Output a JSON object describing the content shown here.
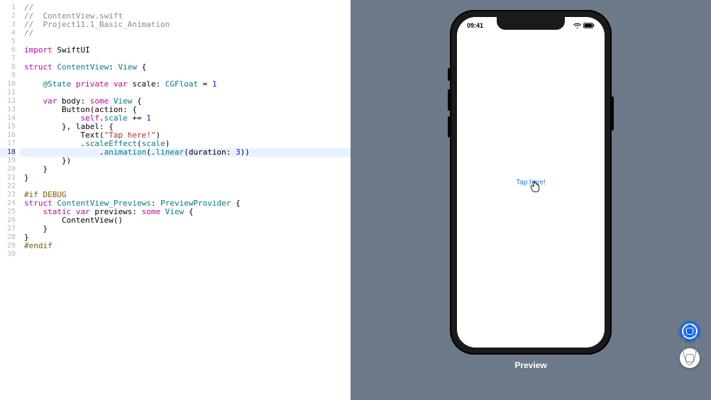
{
  "editor": {
    "highlighted_line": 18,
    "lines": [
      {
        "n": 1,
        "tokens": [
          {
            "t": "//",
            "c": "tok-comment"
          }
        ]
      },
      {
        "n": 2,
        "tokens": [
          {
            "t": "//  ContentView.swift",
            "c": "tok-comment"
          }
        ]
      },
      {
        "n": 3,
        "tokens": [
          {
            "t": "//  Project11.1_Basic_Animation",
            "c": "tok-comment"
          }
        ]
      },
      {
        "n": 4,
        "tokens": [
          {
            "t": "//",
            "c": "tok-comment"
          }
        ]
      },
      {
        "n": 5,
        "tokens": []
      },
      {
        "n": 6,
        "tokens": [
          {
            "t": "import",
            "c": "tok-import"
          },
          {
            "t": " SwiftUI",
            "c": "tok-identifier"
          }
        ]
      },
      {
        "n": 7,
        "tokens": []
      },
      {
        "n": 8,
        "tokens": [
          {
            "t": "struct",
            "c": "tok-keyword"
          },
          {
            "t": " ",
            "c": ""
          },
          {
            "t": "ContentView",
            "c": "tok-typeuser"
          },
          {
            "t": ": ",
            "c": "tok-identifier"
          },
          {
            "t": "View",
            "c": "tok-decl"
          },
          {
            "t": " {",
            "c": "tok-identifier"
          }
        ]
      },
      {
        "n": 9,
        "tokens": []
      },
      {
        "n": 10,
        "tokens": [
          {
            "t": "    @State",
            "c": "tok-decl"
          },
          {
            "t": " ",
            "c": ""
          },
          {
            "t": "private",
            "c": "tok-keyword"
          },
          {
            "t": " ",
            "c": ""
          },
          {
            "t": "var",
            "c": "tok-keyword"
          },
          {
            "t": " scale: ",
            "c": "tok-identifier"
          },
          {
            "t": "CGFloat",
            "c": "tok-decl"
          },
          {
            "t": " = ",
            "c": "tok-identifier"
          },
          {
            "t": "1",
            "c": "tok-number"
          }
        ]
      },
      {
        "n": 11,
        "tokens": []
      },
      {
        "n": 12,
        "tokens": [
          {
            "t": "    ",
            "c": ""
          },
          {
            "t": "var",
            "c": "tok-keyword"
          },
          {
            "t": " body: ",
            "c": "tok-identifier"
          },
          {
            "t": "some",
            "c": "tok-keyword"
          },
          {
            "t": " ",
            "c": ""
          },
          {
            "t": "View",
            "c": "tok-decl"
          },
          {
            "t": " {",
            "c": "tok-identifier"
          }
        ]
      },
      {
        "n": 13,
        "tokens": [
          {
            "t": "        Button(action: {",
            "c": "tok-identifier"
          }
        ]
      },
      {
        "n": 14,
        "tokens": [
          {
            "t": "            ",
            "c": ""
          },
          {
            "t": "self",
            "c": "tok-self"
          },
          {
            "t": ".",
            "c": "tok-identifier"
          },
          {
            "t": "scale",
            "c": "tok-method"
          },
          {
            "t": " += ",
            "c": "tok-identifier"
          },
          {
            "t": "1",
            "c": "tok-number"
          }
        ]
      },
      {
        "n": 15,
        "tokens": [
          {
            "t": "        }, label: {",
            "c": "tok-identifier"
          }
        ]
      },
      {
        "n": 16,
        "tokens": [
          {
            "t": "            Text(",
            "c": "tok-identifier"
          },
          {
            "t": "\"Tap here!\"",
            "c": "tok-string"
          },
          {
            "t": ")",
            "c": "tok-identifier"
          }
        ]
      },
      {
        "n": 17,
        "tokens": [
          {
            "t": "            .",
            "c": "tok-identifier"
          },
          {
            "t": "scaleEffect",
            "c": "tok-method"
          },
          {
            "t": "(",
            "c": "tok-identifier"
          },
          {
            "t": "scale",
            "c": "tok-method"
          },
          {
            "t": ")",
            "c": "tok-identifier"
          }
        ]
      },
      {
        "n": 18,
        "tokens": [
          {
            "t": "                .",
            "c": "tok-identifier"
          },
          {
            "t": "animation",
            "c": "tok-method"
          },
          {
            "t": "(.",
            "c": "tok-identifier"
          },
          {
            "t": "linear",
            "c": "tok-method"
          },
          {
            "t": "(duration: ",
            "c": "tok-identifier"
          },
          {
            "t": "3",
            "c": "tok-number"
          },
          {
            "t": "))",
            "c": "tok-identifier"
          }
        ]
      },
      {
        "n": 19,
        "tokens": [
          {
            "t": "        })",
            "c": "tok-identifier"
          }
        ]
      },
      {
        "n": 20,
        "tokens": [
          {
            "t": "    }",
            "c": "tok-identifier"
          }
        ]
      },
      {
        "n": 21,
        "tokens": [
          {
            "t": "}",
            "c": "tok-identifier"
          }
        ]
      },
      {
        "n": 22,
        "tokens": []
      },
      {
        "n": 23,
        "tokens": [
          {
            "t": "#if DEBUG",
            "c": "tok-pound"
          }
        ]
      },
      {
        "n": 24,
        "tokens": [
          {
            "t": "struct",
            "c": "tok-keyword"
          },
          {
            "t": " ",
            "c": ""
          },
          {
            "t": "ContentView_Previews",
            "c": "tok-typeuser"
          },
          {
            "t": ": ",
            "c": "tok-identifier"
          },
          {
            "t": "PreviewProvider",
            "c": "tok-decl"
          },
          {
            "t": " {",
            "c": "tok-identifier"
          }
        ]
      },
      {
        "n": 25,
        "tokens": [
          {
            "t": "    ",
            "c": ""
          },
          {
            "t": "static",
            "c": "tok-keyword"
          },
          {
            "t": " ",
            "c": ""
          },
          {
            "t": "var",
            "c": "tok-keyword"
          },
          {
            "t": " previews: ",
            "c": "tok-identifier"
          },
          {
            "t": "some",
            "c": "tok-keyword"
          },
          {
            "t": " ",
            "c": ""
          },
          {
            "t": "View",
            "c": "tok-decl"
          },
          {
            "t": " {",
            "c": "tok-identifier"
          }
        ]
      },
      {
        "n": 26,
        "tokens": [
          {
            "t": "        ContentView()",
            "c": "tok-identifier"
          }
        ]
      },
      {
        "n": 27,
        "tokens": [
          {
            "t": "    }",
            "c": "tok-identifier"
          }
        ]
      },
      {
        "n": 28,
        "tokens": [
          {
            "t": "}",
            "c": "tok-identifier"
          }
        ]
      },
      {
        "n": 29,
        "tokens": [
          {
            "t": "#endif",
            "c": "tok-pound"
          }
        ]
      },
      {
        "n": 30,
        "tokens": []
      }
    ]
  },
  "preview": {
    "label": "Preview",
    "status_time": "09:41",
    "button_text": "Tap here!"
  }
}
